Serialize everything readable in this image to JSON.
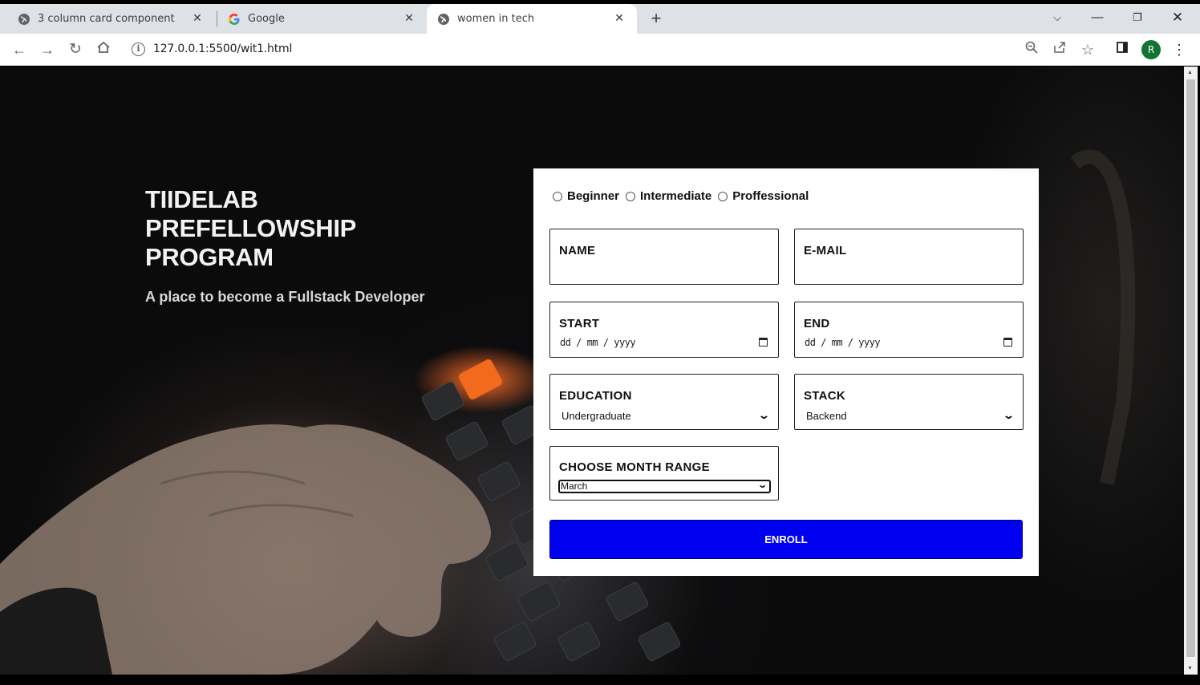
{
  "browser": {
    "tabs": [
      {
        "title": "3 column card component",
        "favicon": "globe-icon",
        "active": false
      },
      {
        "title": "Google",
        "favicon": "google-icon",
        "active": false
      },
      {
        "title": "women in tech",
        "favicon": "globe-icon",
        "active": true
      }
    ],
    "url": "127.0.0.1:5500/wit1.html",
    "profile_initial": "R",
    "profile_color": "#137333"
  },
  "hero": {
    "title": "TIIDELAB PREFELLOWSHIP PROGRAM",
    "subtitle": "A place to become a Fullstack Developer"
  },
  "form": {
    "levels": [
      "Beginner",
      "Intermediate",
      "Proffessional"
    ],
    "name_label": "NAME",
    "email_label": "E-MAIL",
    "start_label": "START",
    "start_placeholder": "dd / mm / yyyy",
    "end_label": "END",
    "end_placeholder": "dd / mm / yyyy",
    "education_label": "EDUCATION",
    "education_value": "Undergraduate",
    "stack_label": "STACK",
    "stack_value": "Backend",
    "month_label": "CHOOSE MONTH RANGE",
    "month_value": "March",
    "submit_label": "ENROLL",
    "submit_color": "#0000f0"
  }
}
